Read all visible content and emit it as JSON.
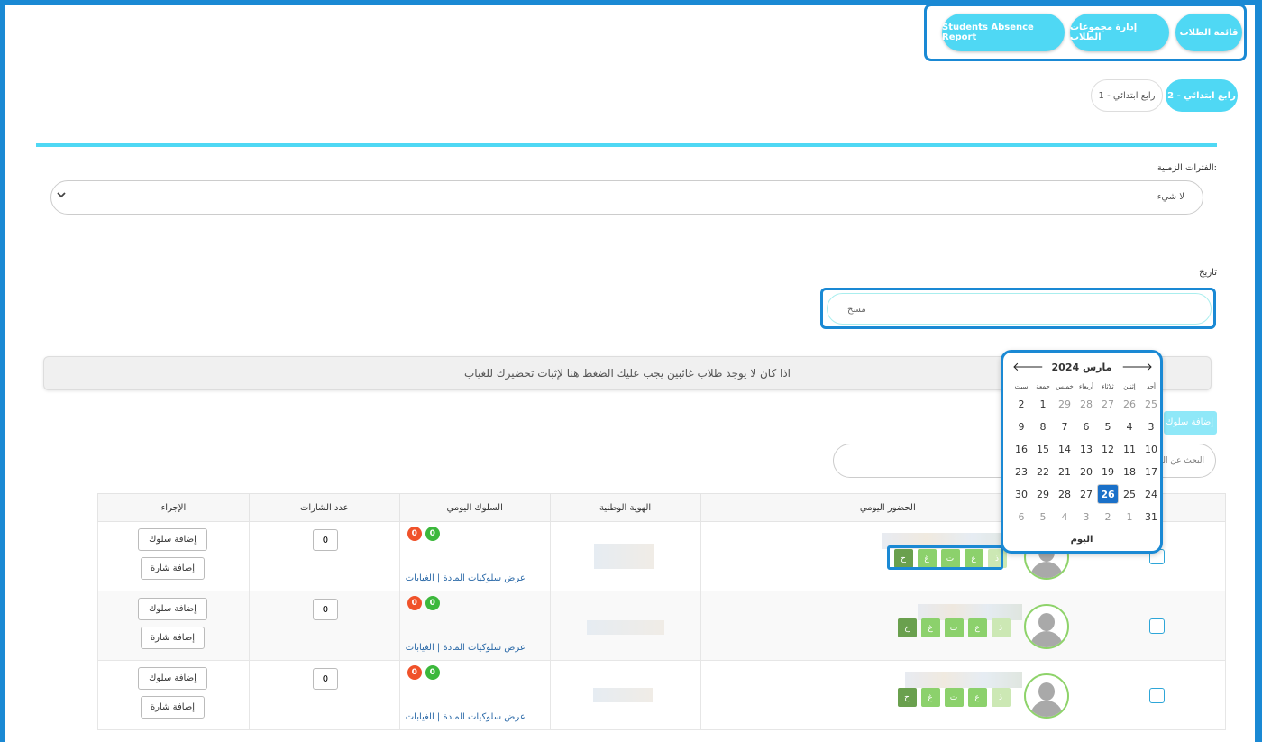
{
  "nav": {
    "student_list": "قائمة الطلاب",
    "manage_groups": "إدارة مجموعات الطلاب",
    "absence_report": "Students Absence Report"
  },
  "classes": [
    {
      "label": "رابع ابتدائي - 2",
      "active": true
    },
    {
      "label": "رابع ابتدائي - 1",
      "active": false
    }
  ],
  "periods": {
    "label": "الفترات الزمنية:",
    "value": "لا شيء"
  },
  "date": {
    "label": "تاريخ",
    "placeholder": "مسح"
  },
  "notice": "اذا كان لا يوجد طلاب غائبين يجب عليك الضغط هنا لإثبات تحضيرك للغياب",
  "add_behavior_bulk": "إضافة سلوك",
  "search_placeholder": "البحث عن الط",
  "table": {
    "headers": [
      "الحضور اليومي",
      "الهوية الوطنية",
      "السلوك اليومي",
      "عدد الشارات",
      "الإجراء"
    ],
    "attendance_codes": [
      "ح",
      "غ",
      "ت",
      "ع",
      "ذ"
    ],
    "rows": [
      {
        "positive": "0",
        "negative": "0",
        "badges_count": "0"
      },
      {
        "positive": "0",
        "negative": "0",
        "badges_count": "0"
      },
      {
        "positive": "0",
        "negative": "0",
        "badges_count": "0"
      }
    ],
    "links_text": "عرض سلوكيات المادة | الغيابات",
    "add_behavior": "إضافة سلوك",
    "add_badge": "إضافة شارة"
  },
  "calendar": {
    "title": "مارس 2024",
    "weekdays": [
      "أحد",
      "إثنين",
      "ثلاثاء",
      "أربعاء",
      "خميس",
      "جمعة",
      "سبت"
    ],
    "weeks": [
      [
        {
          "d": "25",
          "o": true
        },
        {
          "d": "26",
          "o": true
        },
        {
          "d": "27",
          "o": true
        },
        {
          "d": "28",
          "o": true
        },
        {
          "d": "29",
          "o": true
        },
        {
          "d": "1",
          "o": false
        },
        {
          "d": "2",
          "o": false
        }
      ],
      [
        {
          "d": "3",
          "o": false
        },
        {
          "d": "4",
          "o": false
        },
        {
          "d": "5",
          "o": false
        },
        {
          "d": "6",
          "o": false
        },
        {
          "d": "7",
          "o": false
        },
        {
          "d": "8",
          "o": false
        },
        {
          "d": "9",
          "o": false
        }
      ],
      [
        {
          "d": "10",
          "o": false
        },
        {
          "d": "11",
          "o": false
        },
        {
          "d": "12",
          "o": false
        },
        {
          "d": "13",
          "o": false
        },
        {
          "d": "14",
          "o": false
        },
        {
          "d": "15",
          "o": false
        },
        {
          "d": "16",
          "o": false
        }
      ],
      [
        {
          "d": "17",
          "o": false
        },
        {
          "d": "18",
          "o": false
        },
        {
          "d": "19",
          "o": false
        },
        {
          "d": "20",
          "o": false
        },
        {
          "d": "21",
          "o": false
        },
        {
          "d": "22",
          "o": false
        },
        {
          "d": "23",
          "o": false
        }
      ],
      [
        {
          "d": "24",
          "o": false
        },
        {
          "d": "25",
          "o": false
        },
        {
          "d": "26",
          "o": false
        },
        {
          "d": "27",
          "o": false
        },
        {
          "d": "28",
          "o": false
        },
        {
          "d": "29",
          "o": false
        },
        {
          "d": "30",
          "o": false
        }
      ],
      [
        {
          "d": "31",
          "o": false
        },
        {
          "d": "1",
          "o": true
        },
        {
          "d": "2",
          "o": true
        },
        {
          "d": "3",
          "o": true
        },
        {
          "d": "4",
          "o": true
        },
        {
          "d": "5",
          "o": true
        },
        {
          "d": "6",
          "o": true
        }
      ]
    ],
    "selected": "26",
    "today_label": "اليوم"
  },
  "colors": {
    "accent": "#4fd8f4",
    "frame": "#1a89d4",
    "positive": "#3cb83c",
    "negative": "#f0522a",
    "selected_day": "#1a70c8"
  }
}
